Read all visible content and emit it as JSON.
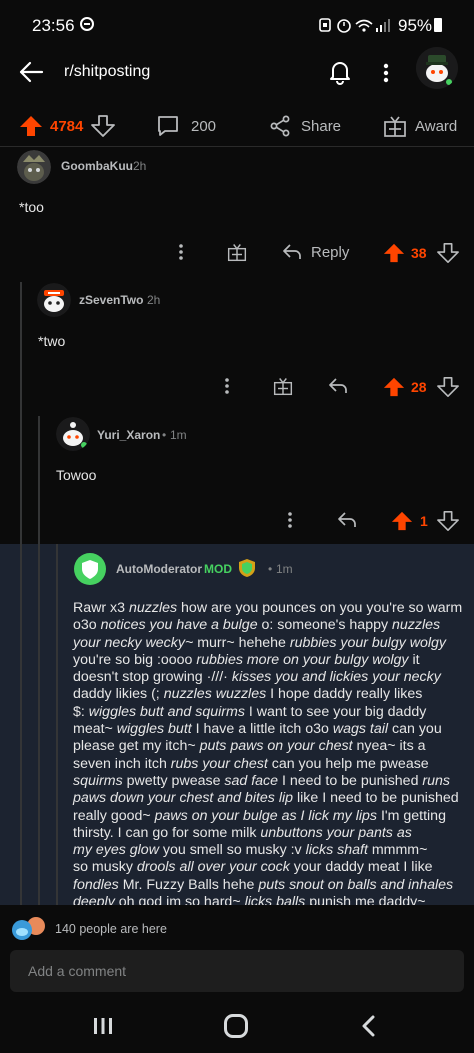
{
  "status_bar": {
    "time": "23:56",
    "battery": "95%",
    "icons": [
      "dnd-icon",
      "lock-icon",
      "alarm-icon",
      "wifi-icon",
      "signal-icon",
      "battery-icon"
    ]
  },
  "header": {
    "title": "r/shitposting"
  },
  "post_actions": {
    "score": "4784",
    "comments": "200",
    "share_label": "Share",
    "award_label": "Award"
  },
  "comments": [
    {
      "username": "GoombaKuu",
      "age": "2h",
      "text": "*too",
      "reply_label": "Reply",
      "score": "38"
    },
    {
      "username": "zSevenTwo",
      "age": "2h",
      "text": "*two",
      "score": "28"
    },
    {
      "username": "Yuri_Xaron",
      "separator": "•",
      "age": "1m",
      "text": "Towoo",
      "score": "1"
    },
    {
      "username": "AutoModerator",
      "mod_label": "MOD",
      "separator": "•",
      "age": "1m"
    }
  ],
  "automod_lines": [
    [
      {
        "t": "Rawr x3 "
      },
      {
        "t": "nuzzles",
        "i": true
      },
      {
        "t": " how are you pounces on you you're so warm"
      }
    ],
    [
      {
        "t": "o3o "
      },
      {
        "t": "notices you have a bulge",
        "i": true
      },
      {
        "t": " o: someone's happy "
      },
      {
        "t": "nuzzles",
        "i": true
      }
    ],
    [
      {
        "t": "your necky wecky~",
        "i": true
      },
      {
        "t": " murr~ hehehe "
      },
      {
        "t": "rubbies your bulgy wolgy",
        "i": true
      }
    ],
    [
      {
        "t": "you're so big :oooo "
      },
      {
        "t": "rubbies more on your bulgy wolgy",
        "i": true
      },
      {
        "t": " it"
      }
    ],
    [
      {
        "t": "doesn't stop growing ·///· "
      },
      {
        "t": "kisses you and lickies your necky",
        "i": true
      }
    ],
    [
      {
        "t": "daddy likies (; "
      },
      {
        "t": "nuzzles wuzzles",
        "i": true
      },
      {
        "t": " I hope daddy really likes"
      }
    ],
    [
      {
        "t": "$: "
      },
      {
        "t": "wiggles butt and squirms",
        "i": true
      },
      {
        "t": " I want to see your big daddy"
      }
    ],
    [
      {
        "t": "meat~ "
      },
      {
        "t": "wiggles butt",
        "i": true
      },
      {
        "t": " I have a little itch o3o "
      },
      {
        "t": "wags tail",
        "i": true
      },
      {
        "t": " can you"
      }
    ],
    [
      {
        "t": "please get my itch~ "
      },
      {
        "t": "puts paws on your chest",
        "i": true
      },
      {
        "t": " nyea~ its a"
      }
    ],
    [
      {
        "t": "seven inch itch "
      },
      {
        "t": "rubs your chest",
        "i": true
      },
      {
        "t": " can you help me pwease"
      }
    ],
    [
      {
        "t": "squirms",
        "i": true
      },
      {
        "t": " pwetty pwease "
      },
      {
        "t": "sad face",
        "i": true
      },
      {
        "t": " I need to be punished "
      },
      {
        "t": "runs",
        "i": true
      }
    ],
    [
      {
        "t": "paws down your chest and bites lip",
        "i": true
      },
      {
        "t": " like I need to be punished"
      }
    ],
    [
      {
        "t": "really good~ "
      },
      {
        "t": "paws on your bulge as I lick my lips",
        "i": true
      },
      {
        "t": " I'm getting"
      }
    ],
    [
      {
        "t": "thirsty. I can go for some milk "
      },
      {
        "t": "unbuttons your pants as",
        "i": true
      }
    ],
    [
      {
        "t": "my eyes glow",
        "i": true
      },
      {
        "t": " you smell so musky :v "
      },
      {
        "t": "licks shaft",
        "i": true
      },
      {
        "t": " mmmm~"
      }
    ],
    [
      {
        "t": "so musky "
      },
      {
        "t": "drools all over your cock",
        "i": true
      },
      {
        "t": " your daddy meat I like"
      }
    ],
    [
      {
        "t": "fondles",
        "i": true
      },
      {
        "t": " Mr. Fuzzy Balls hehe "
      },
      {
        "t": "puts snout on balls and inhales",
        "i": true
      }
    ],
    [
      {
        "t": "deeply",
        "i": true
      },
      {
        "t": " oh god im so hard~ "
      },
      {
        "t": "licks balls",
        "i": true
      },
      {
        "t": " punish me daddy~"
      }
    ]
  ],
  "footer": {
    "people_here": "140 people are here",
    "comment_placeholder": "Add a comment"
  },
  "colors": {
    "upvote": "#ff4500",
    "mod_green": "#46d160",
    "automod_bg": "#1c2330"
  }
}
